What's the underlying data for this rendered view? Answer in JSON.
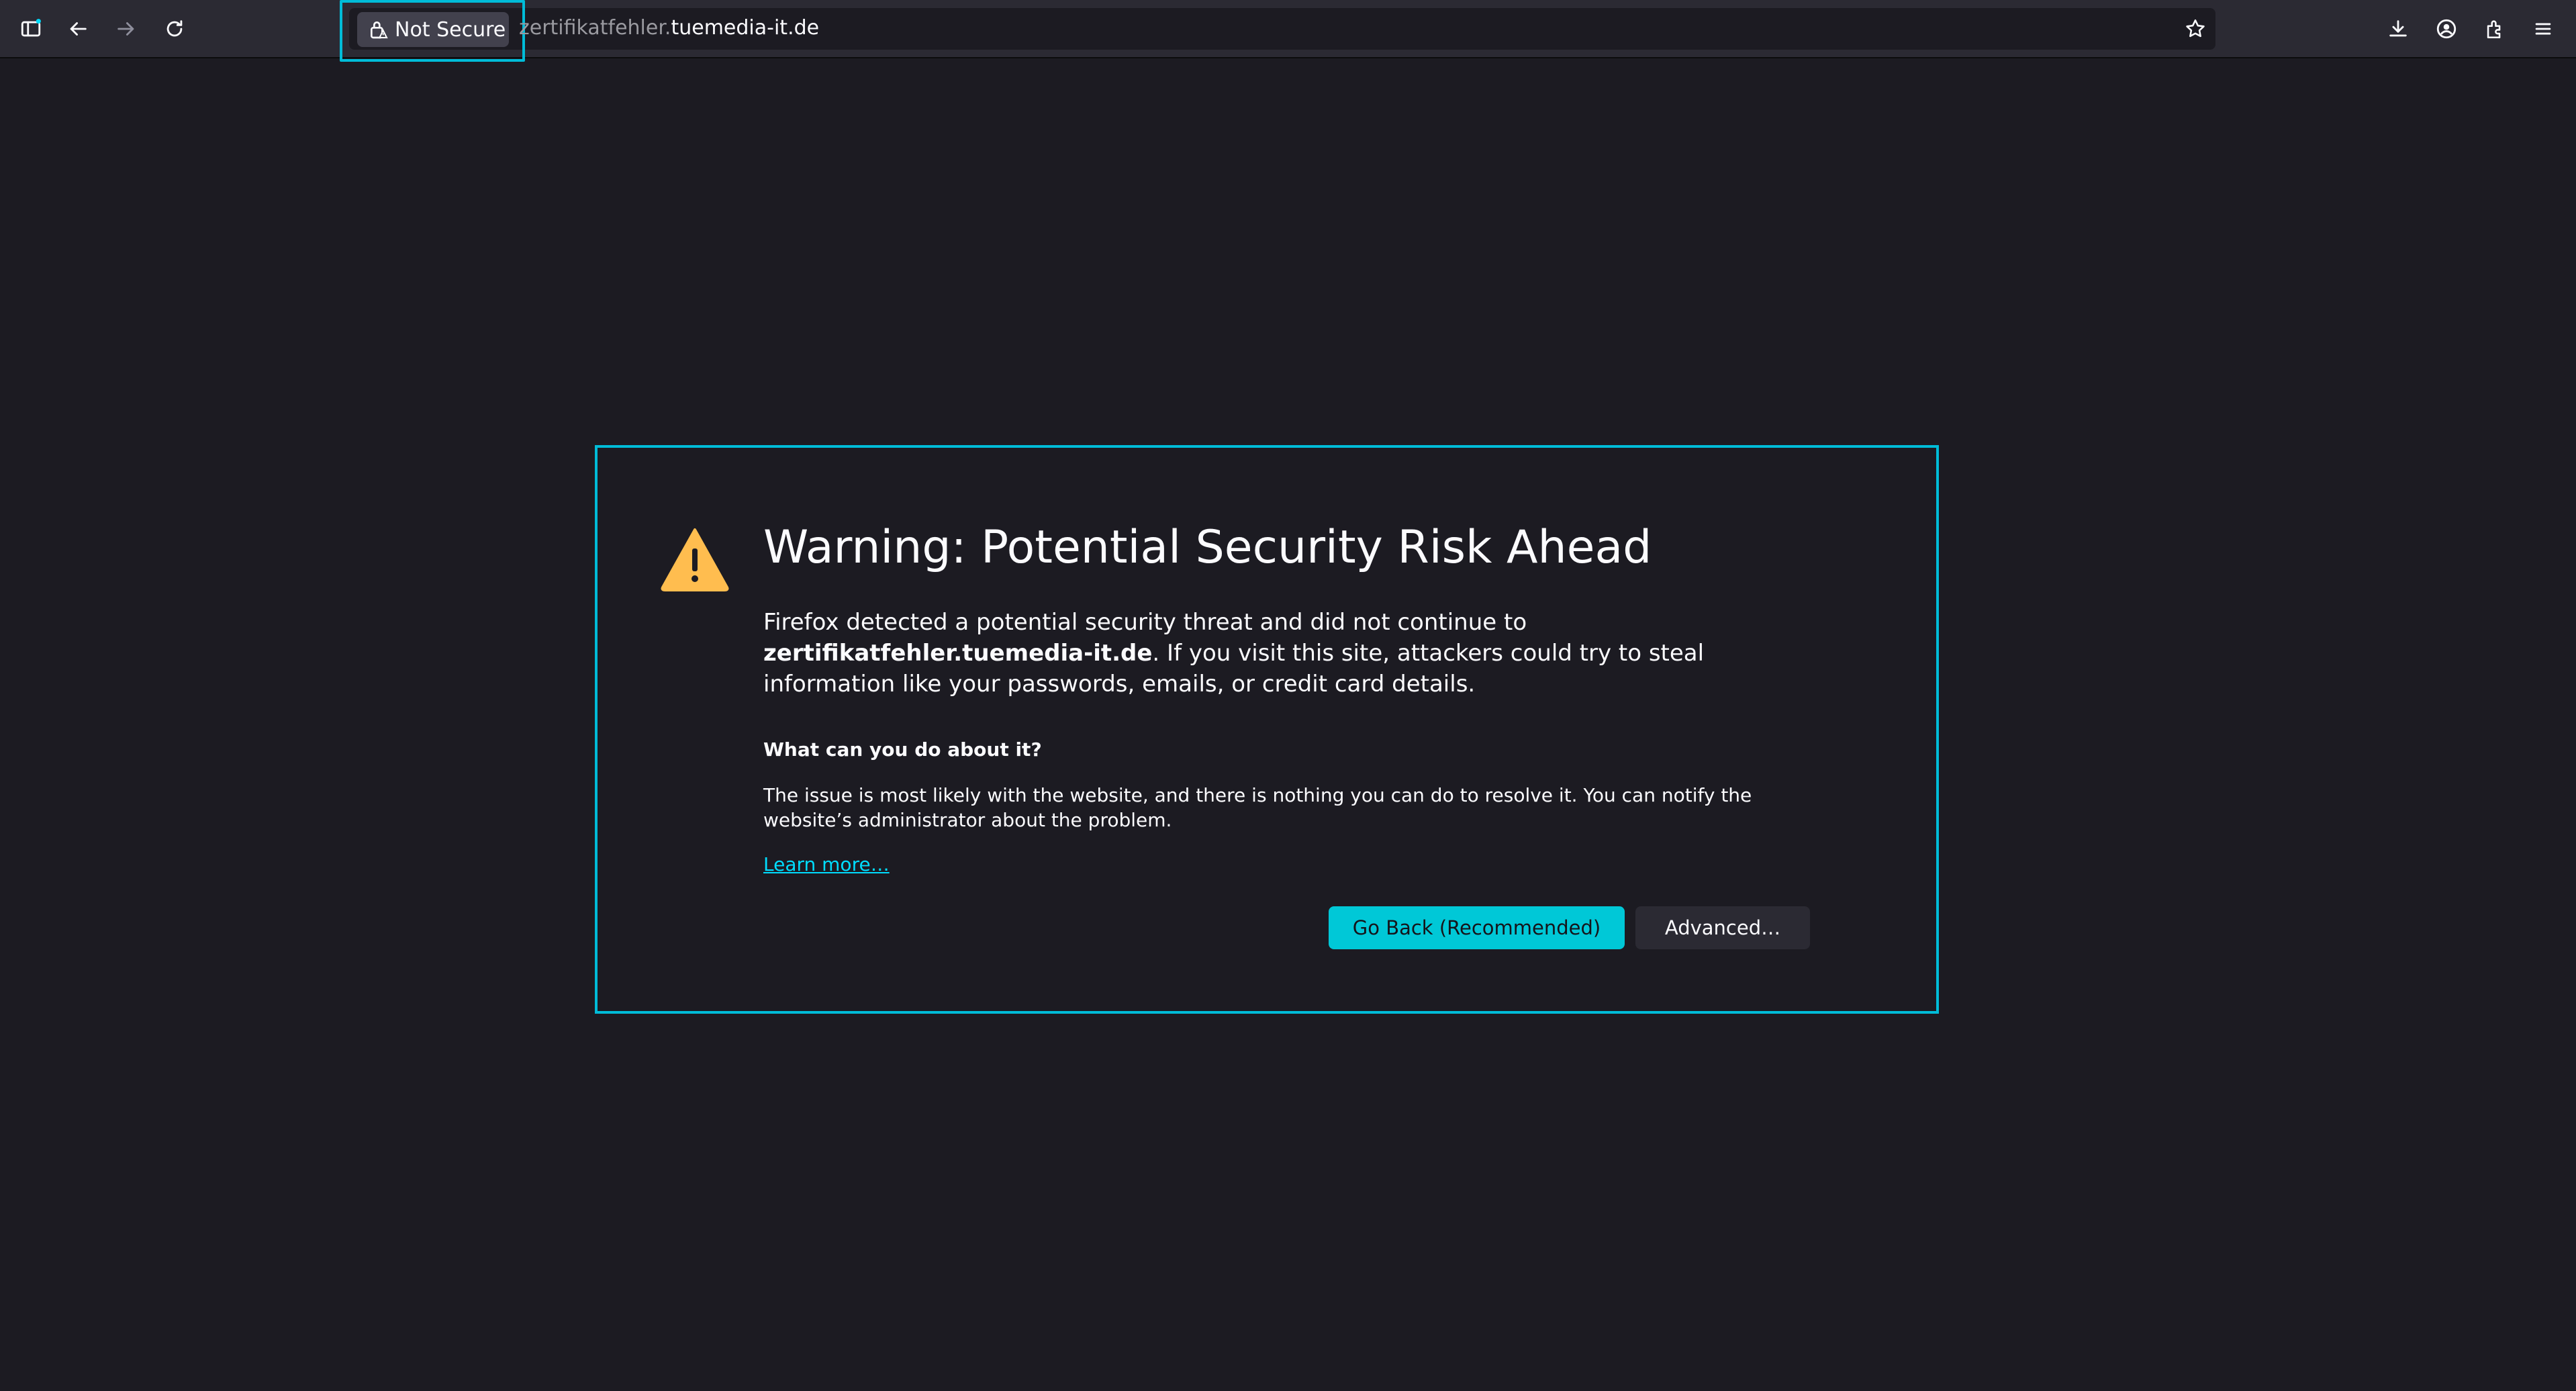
{
  "toolbar": {
    "security_label": "Not Secure",
    "url_subdomain": "zertifikatfehler.",
    "url_domain": "tuemedia-it.de",
    "icons": [
      "sidebar-icon",
      "back-arrow-icon",
      "forward-arrow-icon",
      "reload-icon",
      "lock-warning-icon",
      "star-icon",
      "download-icon",
      "account-icon",
      "extensions-icon",
      "menu-icon"
    ]
  },
  "error": {
    "title": "Warning: Potential Security Risk Ahead",
    "desc_prefix": "Firefox detected a potential security threat and did not continue to ",
    "desc_domain": "zertifikatfehler.tuemedia-it.de",
    "desc_suffix": ". If you visit this site, attackers could try to steal information like your passwords, emails, or credit card details.",
    "subheading": "What can you do about it?",
    "issue_text": "The issue is most likely with the website, and there is nothing you can do to resolve it. You can notify the website’s administrator about the problem.",
    "learn_more": "Learn more…",
    "go_back_label": "Go Back (Recommended)",
    "advanced_label": "Advanced…"
  },
  "colors": {
    "background": "#1c1b22",
    "toolbar": "#2b2a33",
    "accent": "#00c8d7",
    "highlight": "#00bcd8",
    "warning": "#ffbd4f",
    "link": "#00ddff"
  }
}
